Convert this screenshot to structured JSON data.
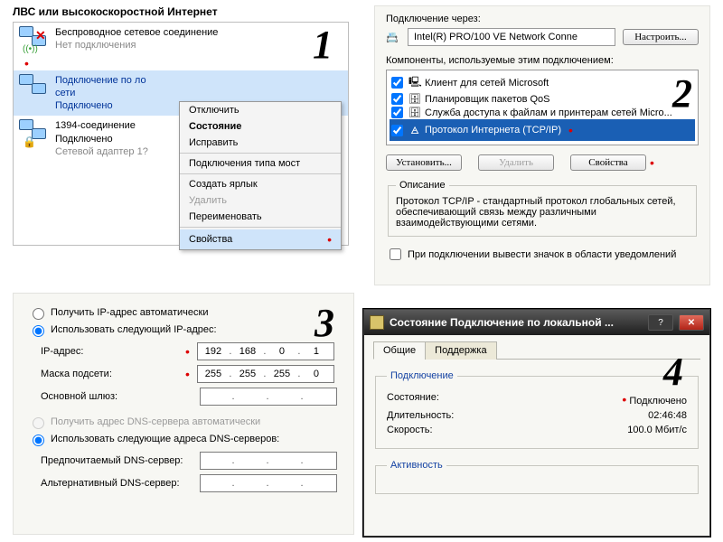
{
  "steps": {
    "n1": "1",
    "n2": "2",
    "n3": "3",
    "n4": "4"
  },
  "panel1": {
    "title": "ЛВС или высокоскоростной Интернет",
    "wireless": {
      "name": "Беспроводное сетевое соединение",
      "status": "Нет подключения"
    },
    "lan": {
      "name": "Подключение по ло\nсети",
      "status": "Подключено"
    },
    "fw": {
      "name": "1394-соединение",
      "status": "Подключено",
      "adapter": "Сетевой адаптер 1?"
    },
    "menu": {
      "disable": "Отключить",
      "status": "Состояние",
      "repair": "Исправить",
      "bridge": "Подключения типа мост",
      "shortcut": "Создать ярлык",
      "delete": "Удалить",
      "rename": "Переименовать",
      "props": "Свойства"
    }
  },
  "panel2": {
    "via_label": "Подключение через:",
    "adapter": "Intel(R) PRO/100 VE Network Conne",
    "configure": "Настроить...",
    "components_label": "Компоненты, используемые этим подключением:",
    "comp": {
      "client": "Клиент для сетей Microsoft",
      "qos": "Планировщик пакетов QoS",
      "fileprint": "Служба доступа к файлам и принтерам сетей Micro...",
      "tcpip": "Протокол Интернета (TCP/IP)"
    },
    "install": "Установить...",
    "remove": "Удалить",
    "properties": "Свойства",
    "desc_title": "Описание",
    "desc_text": "Протокол TCP/IP - стандартный протокол глобальных сетей, обеспечивающий связь между различными взаимодействующими сетями.",
    "notify": "При подключении вывести значок в области уведомлений"
  },
  "panel3": {
    "auto_ip": "Получить IP-адрес автоматически",
    "manual_ip": "Использовать следующий IP-адрес:",
    "ip_label": "IP-адрес:",
    "mask_label": "Маска подсети:",
    "gw_label": "Основной шлюз:",
    "ip": [
      "192",
      "168",
      "0",
      "1"
    ],
    "mask": [
      "255",
      "255",
      "255",
      "0"
    ],
    "gw": [
      "",
      "",
      "",
      ""
    ],
    "auto_dns": "Получить адрес DNS-сервера автоматически",
    "manual_dns": "Использовать следующие адреса DNS-серверов:",
    "dns1_label": "Предпочитаемый DNS-сервер:",
    "dns2_label": "Альтернативный DNS-сервер:",
    "dns1": [
      "",
      "",
      "",
      ""
    ],
    "dns2": [
      "",
      "",
      "",
      ""
    ]
  },
  "panel4": {
    "title": "Состояние Подключение по локальной ...",
    "tab_general": "Общие",
    "tab_support": "Поддержка",
    "grp_conn": "Подключение",
    "state_lbl": "Состояние:",
    "state_val": "Подключено",
    "dur_lbl": "Длительность:",
    "dur_val": "02:46:48",
    "speed_lbl": "Скорость:",
    "speed_val": "100.0 Мбит/с",
    "grp_act": "Активность"
  }
}
